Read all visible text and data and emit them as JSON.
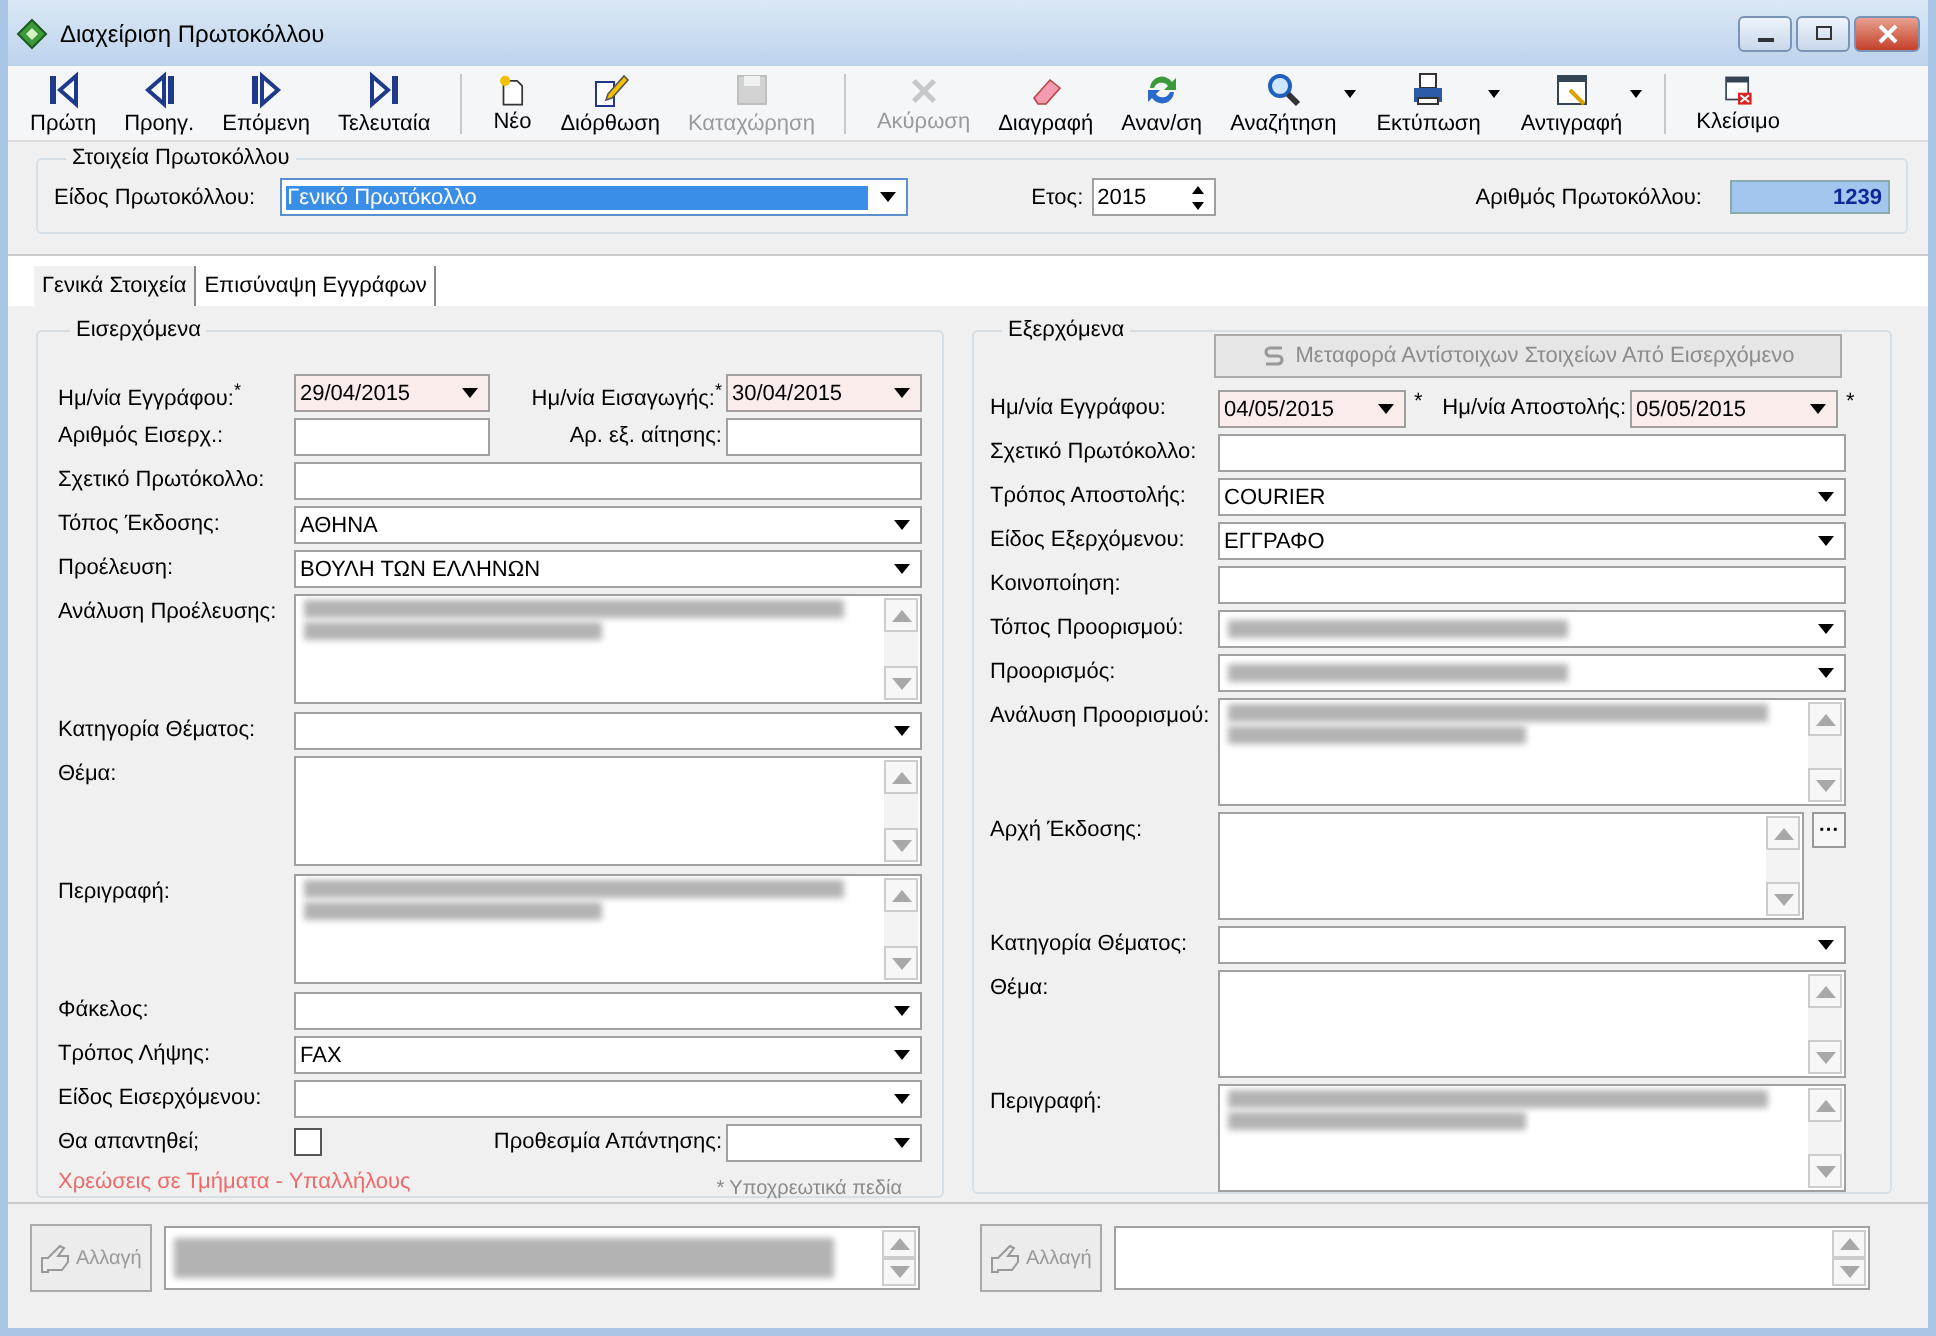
{
  "window": {
    "title": "Διαχείριση Πρωτοκόλλου"
  },
  "toolbar": [
    {
      "label": "Πρώτη",
      "kind": "first",
      "disabled": false,
      "dropdown": false,
      "separator_before": false
    },
    {
      "label": "Προηγ.",
      "kind": "prev",
      "disabled": false,
      "dropdown": false,
      "separator_before": false
    },
    {
      "label": "Επόμενη",
      "kind": "next",
      "disabled": false,
      "dropdown": false,
      "separator_before": false
    },
    {
      "label": "Τελευταία",
      "kind": "last",
      "disabled": false,
      "dropdown": false,
      "separator_before": false
    },
    {
      "label": "Νέο",
      "kind": "new",
      "disabled": false,
      "dropdown": false,
      "separator_before": true
    },
    {
      "label": "Διόρθωση",
      "kind": "edit",
      "disabled": false,
      "dropdown": false,
      "separator_before": false
    },
    {
      "label": "Καταχώρηση",
      "kind": "save",
      "disabled": true,
      "dropdown": false,
      "separator_before": false
    },
    {
      "label": "Ακύρωση",
      "kind": "cancel",
      "disabled": true,
      "dropdown": false,
      "separator_before": true
    },
    {
      "label": "Διαγραφή",
      "kind": "delete",
      "disabled": false,
      "dropdown": false,
      "separator_before": false
    },
    {
      "label": "Αναν/ση",
      "kind": "refresh",
      "disabled": false,
      "dropdown": false,
      "separator_before": false
    },
    {
      "label": "Αναζήτηση",
      "kind": "search",
      "disabled": false,
      "dropdown": true,
      "separator_before": false
    },
    {
      "label": "Εκτύπωση",
      "kind": "print",
      "disabled": false,
      "dropdown": true,
      "separator_before": false
    },
    {
      "label": "Αντιγραφή",
      "kind": "copy",
      "disabled": false,
      "dropdown": true,
      "separator_before": false
    },
    {
      "label": "Κλείσιμο",
      "kind": "close",
      "disabled": false,
      "dropdown": false,
      "separator_before": true
    }
  ],
  "header": {
    "title": "Στοιχεία Πρωτοκόλλου",
    "type_label": "Είδος Πρωτοκόλλου:",
    "type_value": "Γενικό Πρωτόκολλο",
    "year_label": "Ετος:",
    "year_value": "2015",
    "number_label": "Αριθμός Πρωτοκόλλου:",
    "number_value": "1239"
  },
  "tabs": [
    {
      "label": "Γενικά Στοιχεία",
      "selected": true
    },
    {
      "label": "Επισύναψη Εγγράφων",
      "selected": false
    }
  ],
  "incoming": {
    "title": "Εισερχόμενα",
    "rows": [
      {
        "kind": "pair",
        "label": "Ημ/νία Εγγράφου:",
        "label_mark": "*",
        "field": {
          "kind": "date",
          "value": "29/04/2015"
        },
        "label2": "Ημ/νία Εισαγωγής:",
        "label2_mark": "*",
        "field2": {
          "kind": "date",
          "value": "30/04/2015"
        }
      },
      {
        "kind": "pair",
        "label": "Αριθμός Εισερχ.:",
        "field": {
          "kind": "text"
        },
        "label2": "Αρ. εξ. αίτησης:",
        "field2": {
          "kind": "text"
        }
      },
      {
        "kind": "single",
        "label": "Σχετικό Πρωτόκολλο:",
        "field": {
          "kind": "text"
        }
      },
      {
        "kind": "single",
        "label": "Τόπος Έκδοσης:",
        "field": {
          "kind": "combo",
          "value": "ΑΘΗΝΑ"
        }
      },
      {
        "kind": "single",
        "label": "Προέλευση:",
        "field": {
          "kind": "combo",
          "value": "ΒΟΥΛΗ ΤΩΝ ΕΛΛΗΝΩΝ"
        }
      },
      {
        "kind": "single",
        "label": "Ανάλυση Προέλευσης:",
        "field": {
          "kind": "memo",
          "blurred": true
        }
      },
      {
        "kind": "single",
        "label": "Κατηγορία Θέματος:",
        "field": {
          "kind": "combo"
        }
      },
      {
        "kind": "single",
        "label": "Θέμα:",
        "field": {
          "kind": "memo"
        }
      },
      {
        "kind": "single",
        "label": "Περιγραφή:",
        "field": {
          "kind": "memo",
          "blurred": true
        }
      },
      {
        "kind": "single",
        "label": "Φάκελος:",
        "field": {
          "kind": "combo"
        }
      },
      {
        "kind": "single",
        "label": "Τρόπος Λήψης:",
        "field": {
          "kind": "combo",
          "value": "FAX"
        }
      },
      {
        "kind": "single",
        "label": "Είδος Εισερχόμενου:",
        "field": {
          "kind": "combo"
        }
      },
      {
        "kind": "pair",
        "label": "Θα απαντηθεί;",
        "field": {
          "kind": "check",
          "checked": false
        },
        "label2": "Προθεσμία Απάντησης:",
        "field2": {
          "kind": "combo"
        }
      }
    ],
    "link": "Χρεώσεις σε Τμήματα - Υπαλλήλους",
    "note": "* Υποχρεωτικά πεδία"
  },
  "outgoing": {
    "title": "Εξερχόμενα",
    "action": {
      "label": "Μεταφορά Αντίστοιχων Στοιχείων Από Εισερχόμενο",
      "disabled": true
    },
    "rows": [
      {
        "kind": "pair",
        "label": "Ημ/νία Εγγράφου:",
        "field": {
          "kind": "date",
          "value": "04/05/2015",
          "after": "*"
        },
        "label2": "Ημ/νία Αποστολής:",
        "field2": {
          "kind": "date",
          "value": "05/05/2015",
          "after": "*"
        }
      },
      {
        "kind": "single",
        "label": "Σχετικό Πρωτόκολλο:",
        "field": {
          "kind": "text"
        }
      },
      {
        "kind": "single",
        "label": "Τρόπος Αποστολής:",
        "field": {
          "kind": "combo",
          "value": "COURIER"
        }
      },
      {
        "kind": "single",
        "label": "Είδος Εξερχόμενου:",
        "field": {
          "kind": "combo",
          "value": "ΕΓΓΡΑΦΟ"
        }
      },
      {
        "kind": "single",
        "label": "Κοινοποίηση:",
        "field": {
          "kind": "text"
        }
      },
      {
        "kind": "single",
        "label": "Τόπος Προορισμού:",
        "field": {
          "kind": "combo",
          "blurred": true
        }
      },
      {
        "kind": "single",
        "label": "Προορισμός:",
        "field": {
          "kind": "combo",
          "blurred": true
        }
      },
      {
        "kind": "single",
        "label": "Ανάλυση Προορισμού:",
        "field": {
          "kind": "memo",
          "blurred": true
        }
      },
      {
        "kind": "single",
        "label": "Αρχή Έκδοσης:",
        "field": {
          "kind": "memo",
          "side_button": "···"
        }
      },
      {
        "kind": "single",
        "label": "Κατηγορία Θέματος:",
        "field": {
          "kind": "combo"
        }
      },
      {
        "kind": "single",
        "label": "Θέμα:",
        "field": {
          "kind": "memo"
        }
      },
      {
        "kind": "single",
        "label": "Περιγραφή:",
        "field": {
          "kind": "memo",
          "blurred": true
        }
      }
    ]
  },
  "bottom": [
    {
      "button": "Αλλαγή",
      "disabled": true,
      "blurred": true
    },
    {
      "button": "Αλλαγή",
      "disabled": true,
      "blurred": false
    }
  ]
}
